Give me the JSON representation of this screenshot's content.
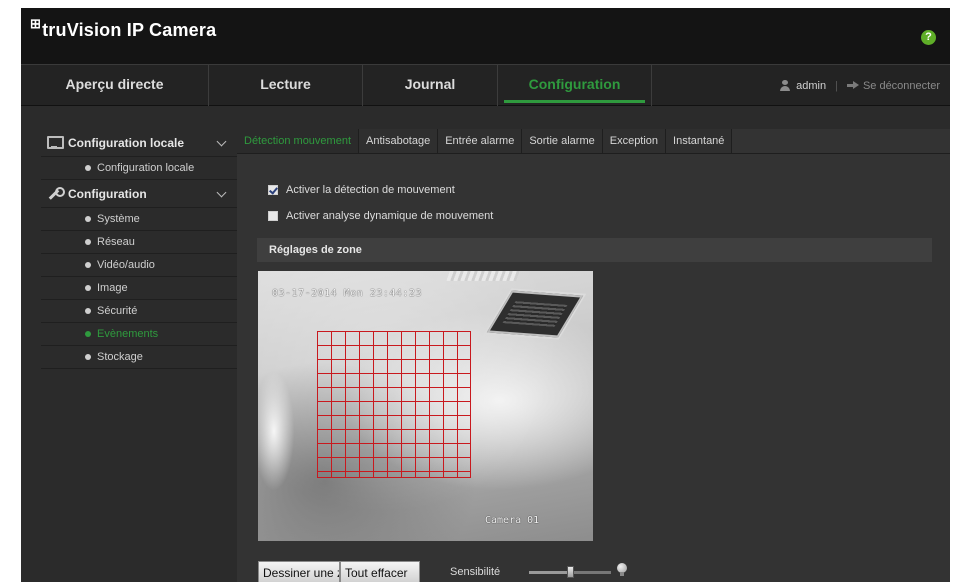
{
  "app": {
    "logo_mark": "⊞",
    "title": "truVision IP Camera"
  },
  "colors": {
    "accent_green": "#2f9a3e",
    "grid_red": "#c8191e",
    "help_green": "#5fae28"
  },
  "nav": {
    "tabs": [
      {
        "label": "Aperçu directe"
      },
      {
        "label": "Lecture"
      },
      {
        "label": "Journal"
      },
      {
        "label": "Configuration",
        "active": true
      }
    ],
    "user": "admin",
    "separator": "|",
    "logout": "Se déconnecter"
  },
  "help": {
    "glyph": "?"
  },
  "sidebar": {
    "groups": [
      {
        "label": "Configuration locale",
        "icon": "monitor-icon",
        "items": [
          {
            "label": "Configuration locale"
          }
        ]
      },
      {
        "label": "Configuration",
        "icon": "wrench-icon",
        "items": [
          {
            "label": "Système"
          },
          {
            "label": "Réseau"
          },
          {
            "label": "Vidéo/audio"
          },
          {
            "label": "Image"
          },
          {
            "label": "Sécurité"
          },
          {
            "label": "Evènements",
            "active": true
          },
          {
            "label": "Stockage"
          }
        ]
      }
    ]
  },
  "content": {
    "subtabs": [
      {
        "label": "Détection mouvement",
        "active": true
      },
      {
        "label": "Antisabotage"
      },
      {
        "label": "Entrée alarme"
      },
      {
        "label": "Sortie alarme"
      },
      {
        "label": "Exception"
      },
      {
        "label": "Instantané"
      }
    ],
    "checks": [
      {
        "label": "Activer la détection de mouvement",
        "checked": true
      },
      {
        "label": "Activer analyse dynamique de mouvement",
        "checked": false
      }
    ],
    "zone_title": "Réglages de zone",
    "camera": {
      "timestamp": "03-17-2014 Mon 23:44:23",
      "name": "Camera 01"
    },
    "draw_button": "Dessiner une zone",
    "clear_button": "Tout effacer",
    "sensitivity_label": "Sensibilité",
    "sensitivity_value": 0.5
  }
}
